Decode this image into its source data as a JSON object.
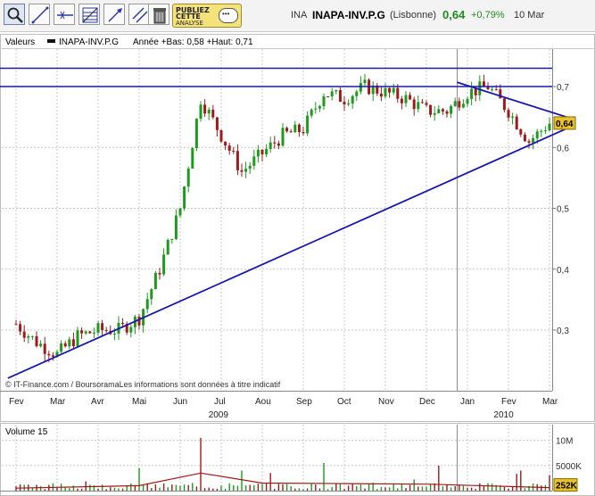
{
  "toolbar": {
    "buttons": [
      {
        "name": "zoom-tool-button",
        "icon": "magnifier-zoom-icon"
      },
      {
        "name": "trendline-tool-button",
        "icon": "trendline-icon"
      },
      {
        "name": "horizontal-line-tool-button",
        "icon": "horizontal-line-icon"
      },
      {
        "name": "fibonacci-tool-button",
        "icon": "fibonacci-icon"
      },
      {
        "name": "arrow-tool-button",
        "icon": "arrow-line-icon"
      },
      {
        "name": "parallel-lines-tool-button",
        "icon": "parallel-lines-icon"
      },
      {
        "name": "delete-button",
        "icon": "trash-icon"
      }
    ],
    "ad": {
      "line1": "PUBLIEZ",
      "line2": "CETTE",
      "line3": "ANALYSE"
    }
  },
  "ticker": {
    "code": "INA",
    "name": "INAPA-INV.P.G",
    "market": "(Lisbonne)",
    "price": "0,64",
    "change": "+0,79%",
    "date": "10 Mar"
  },
  "chart_data": [
    {
      "type": "candlestick",
      "legend": {
        "section": "Valeurs",
        "series": "INAPA-INV.P.G",
        "stats": "Année +Bas: 0,58 +Haut: 0,71"
      },
      "x_months": [
        "Fev",
        "Mar",
        "Avr",
        "Mai",
        "Jun",
        "Jul",
        "Aou",
        "Sep",
        "Oct",
        "Nov",
        "Dec",
        "Jan",
        "Fev",
        "Mar"
      ],
      "x_years": [
        "2009",
        "2010"
      ],
      "ylim": [
        0.22,
        0.76
      ],
      "y_ticks": [
        "0,7",
        "0,6",
        "0,5",
        "0,4",
        "0,3"
      ],
      "last_price_label": "0,64",
      "close_path": [
        [
          0,
          0.31
        ],
        [
          0.5,
          0.28
        ],
        [
          1,
          0.26
        ],
        [
          1.5,
          0.29
        ],
        [
          2,
          0.3
        ],
        [
          2.5,
          0.3
        ],
        [
          3,
          0.32
        ],
        [
          3.5,
          0.4
        ],
        [
          4,
          0.5
        ],
        [
          4.5,
          0.68
        ],
        [
          5,
          0.62
        ],
        [
          5.5,
          0.56
        ],
        [
          6,
          0.59
        ],
        [
          6.5,
          0.62
        ],
        [
          7,
          0.63
        ],
        [
          7.5,
          0.69
        ],
        [
          8,
          0.68
        ],
        [
          8.5,
          0.7
        ],
        [
          9,
          0.69
        ],
        [
          9.5,
          0.68
        ],
        [
          10,
          0.66
        ],
        [
          10.5,
          0.66
        ],
        [
          11,
          0.69
        ],
        [
          11.5,
          0.7
        ],
        [
          12,
          0.66
        ],
        [
          12.5,
          0.61
        ],
        [
          13,
          0.64
        ]
      ],
      "horizontal_lines": [
        0.73,
        0.7
      ],
      "trendlines": [
        {
          "from": [
            -0.2,
            0.221
          ],
          "to": [
            13.55,
            0.635
          ]
        },
        {
          "from": [
            10.75,
            0.707
          ],
          "to": [
            13.55,
            0.647
          ]
        }
      ],
      "footer": "© IT-Finance.com / BoursoramaLes informations sont données à titre indicatif"
    },
    {
      "type": "bar",
      "title": "Volume 15",
      "y_ticks": [
        "10M",
        "5000K"
      ],
      "last_value_label": "252K",
      "ylim": [
        0,
        11
      ],
      "peaks": [
        [
          3.0,
          4.5
        ],
        [
          4.5,
          10.5
        ],
        [
          5.5,
          4.0
        ],
        [
          7.5,
          5.5
        ],
        [
          10.3,
          5.0
        ],
        [
          12.3,
          4.0
        ]
      ],
      "moving_average": [
        [
          0,
          0.5
        ],
        [
          3,
          1.0
        ],
        [
          4.5,
          3.5
        ],
        [
          6,
          1.5
        ],
        [
          8,
          1.4
        ],
        [
          10,
          1.3
        ],
        [
          13,
          0.6
        ]
      ]
    }
  ],
  "colors": {
    "up": "#1e9a1e",
    "down": "#9c1b1b",
    "lines": "#1a1aa8",
    "grid": "#c9c9c9",
    "ma": "#a01818",
    "price_box": "#e9c229"
  }
}
